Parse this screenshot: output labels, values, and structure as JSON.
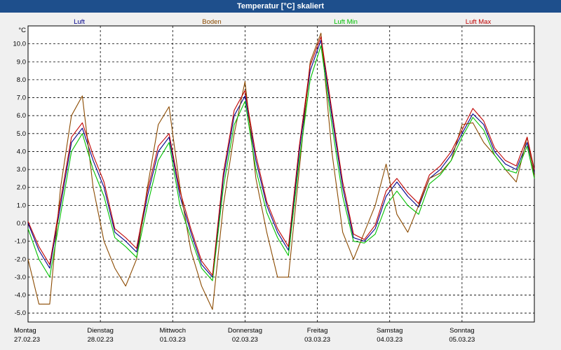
{
  "window": {
    "title": "Temperatur [°C] skaliert"
  },
  "chart_data": {
    "type": "line",
    "title": "Temperatur [°C] skaliert",
    "ylabel": "°C",
    "ylim": [
      -5.5,
      11.0
    ],
    "yticks": [
      "10.0",
      "9.0",
      "8.0",
      "7.0",
      "6.0",
      "5.0",
      "4.0",
      "3.0",
      "2.0",
      "1.0",
      "0.0",
      "-1.0",
      "-2.0",
      "-3.0",
      "-4.0",
      "-5.0"
    ],
    "ytick_values": [
      10,
      9,
      8,
      7,
      6,
      5,
      4,
      3,
      2,
      1,
      0,
      -1,
      -2,
      -3,
      -4,
      -5
    ],
    "xlim": [
      0,
      7
    ],
    "days": [
      {
        "weekday": "Montag",
        "date": "27.02.23"
      },
      {
        "weekday": "Dienstag",
        "date": "28.02.23"
      },
      {
        "weekday": "Mittwoch",
        "date": "01.03.23"
      },
      {
        "weekday": "Donnerstag",
        "date": "02.03.23"
      },
      {
        "weekday": "Freitag",
        "date": "03.03.23"
      },
      {
        "weekday": "Samstag",
        "date": "04.03.23"
      },
      {
        "weekday": "Sonntag",
        "date": "05.03.23"
      }
    ],
    "grid": true,
    "legend_position": "top",
    "series": [
      {
        "name": "Luft",
        "color": "#00008b",
        "x": [
          0,
          0.15,
          0.3,
          0.45,
          0.6,
          0.75,
          0.9,
          1.05,
          1.2,
          1.35,
          1.5,
          1.65,
          1.8,
          1.95,
          2.1,
          2.25,
          2.4,
          2.55,
          2.7,
          2.85,
          3.0,
          3.15,
          3.3,
          3.45,
          3.6,
          3.75,
          3.9,
          4.05,
          4.2,
          4.35,
          4.5,
          4.65,
          4.8,
          4.95,
          5.1,
          5.25,
          5.4,
          5.55,
          5.7,
          5.85,
          6.0,
          6.15,
          6.3,
          6.45,
          6.6,
          6.75,
          6.9,
          7.0
        ],
        "y": [
          0,
          -1.5,
          -2.5,
          1.0,
          4.5,
          5.3,
          3.5,
          2.0,
          -0.5,
          -1.0,
          -1.6,
          1.5,
          4.0,
          4.8,
          1.5,
          -0.5,
          -2.3,
          -3.0,
          2.5,
          6.0,
          7.1,
          3.5,
          1.0,
          -0.5,
          -1.5,
          4.0,
          8.5,
          10.2,
          6.0,
          2.0,
          -0.8,
          -1.0,
          -0.3,
          1.5,
          2.3,
          1.5,
          0.9,
          2.5,
          3.0,
          3.8,
          5.0,
          6.1,
          5.5,
          4.0,
          3.3,
          3.0,
          4.5,
          2.8
        ]
      },
      {
        "name": "Boden",
        "color": "#8b4a00",
        "x": [
          0,
          0.15,
          0.3,
          0.45,
          0.6,
          0.75,
          0.9,
          1.05,
          1.2,
          1.35,
          1.5,
          1.65,
          1.8,
          1.95,
          2.1,
          2.25,
          2.4,
          2.55,
          2.7,
          2.85,
          3.0,
          3.15,
          3.3,
          3.45,
          3.6,
          3.75,
          3.9,
          4.05,
          4.2,
          4.35,
          4.5,
          4.65,
          4.8,
          4.95,
          5.1,
          5.25,
          5.4,
          5.55,
          5.7,
          5.85,
          6.0,
          6.15,
          6.3,
          6.45,
          6.6,
          6.75,
          6.9,
          7.0
        ],
        "y": [
          -2.0,
          -4.5,
          -4.5,
          2.0,
          6.0,
          7.1,
          2.0,
          -1.0,
          -2.5,
          -3.5,
          -2.0,
          2.0,
          5.5,
          6.5,
          2.0,
          -1.5,
          -3.5,
          -4.8,
          1.0,
          5.0,
          7.9,
          2.5,
          -0.5,
          -3.0,
          -3.0,
          3.0,
          9.0,
          10.6,
          4.0,
          -0.5,
          -2.0,
          -0.5,
          1.0,
          3.3,
          0.5,
          -0.5,
          1.0,
          2.5,
          2.8,
          3.5,
          5.5,
          5.6,
          4.5,
          3.8,
          3.0,
          2.3,
          4.8,
          2.6
        ]
      },
      {
        "name": "Luft Min",
        "color": "#00c000",
        "x": [
          0,
          0.15,
          0.3,
          0.45,
          0.6,
          0.75,
          0.9,
          1.05,
          1.2,
          1.35,
          1.5,
          1.65,
          1.8,
          1.95,
          2.1,
          2.25,
          2.4,
          2.55,
          2.7,
          2.85,
          3.0,
          3.15,
          3.3,
          3.45,
          3.6,
          3.75,
          3.9,
          4.05,
          4.2,
          4.35,
          4.5,
          4.65,
          4.8,
          4.95,
          5.1,
          5.25,
          5.4,
          5.55,
          5.7,
          5.85,
          6.0,
          6.15,
          6.3,
          6.45,
          6.6,
          6.75,
          6.9,
          7.0
        ],
        "y": [
          -0.3,
          -2.0,
          -3.0,
          0.5,
          4.0,
          5.0,
          3.0,
          1.5,
          -0.8,
          -1.3,
          -1.9,
          1.0,
          3.5,
          4.5,
          1.0,
          -0.8,
          -2.5,
          -3.2,
          2.0,
          5.5,
          6.8,
          3.0,
          0.6,
          -0.8,
          -1.8,
          3.5,
          8.0,
          9.9,
          5.5,
          1.5,
          -1.0,
          -1.1,
          -0.6,
          1.0,
          1.8,
          1.0,
          0.5,
          2.2,
          2.7,
          3.5,
          4.8,
          5.9,
          5.2,
          3.8,
          3.0,
          2.8,
          4.3,
          2.5
        ]
      },
      {
        "name": "Luft Max",
        "color": "#c00000",
        "x": [
          0,
          0.15,
          0.3,
          0.45,
          0.6,
          0.75,
          0.9,
          1.05,
          1.2,
          1.35,
          1.5,
          1.65,
          1.8,
          1.95,
          2.1,
          2.25,
          2.4,
          2.55,
          2.7,
          2.85,
          3.0,
          3.15,
          3.3,
          3.45,
          3.6,
          3.75,
          3.9,
          4.05,
          4.2,
          4.35,
          4.5,
          4.65,
          4.8,
          4.95,
          5.1,
          5.25,
          5.4,
          5.55,
          5.7,
          5.85,
          6.0,
          6.15,
          6.3,
          6.45,
          6.6,
          6.75,
          6.9,
          7.0
        ],
        "y": [
          0.1,
          -1.3,
          -2.3,
          1.3,
          4.8,
          5.6,
          3.8,
          2.3,
          -0.3,
          -0.8,
          -1.4,
          1.8,
          4.3,
          5.0,
          1.8,
          -0.3,
          -2.1,
          -2.9,
          2.8,
          6.3,
          7.4,
          3.8,
          1.2,
          -0.3,
          -1.3,
          4.3,
          8.8,
          10.4,
          6.3,
          2.3,
          -0.6,
          -0.9,
          -0.1,
          1.8,
          2.5,
          1.7,
          1.1,
          2.7,
          3.2,
          4.0,
          5.2,
          6.4,
          5.7,
          4.2,
          3.5,
          3.2,
          4.8,
          3.0
        ]
      }
    ]
  }
}
